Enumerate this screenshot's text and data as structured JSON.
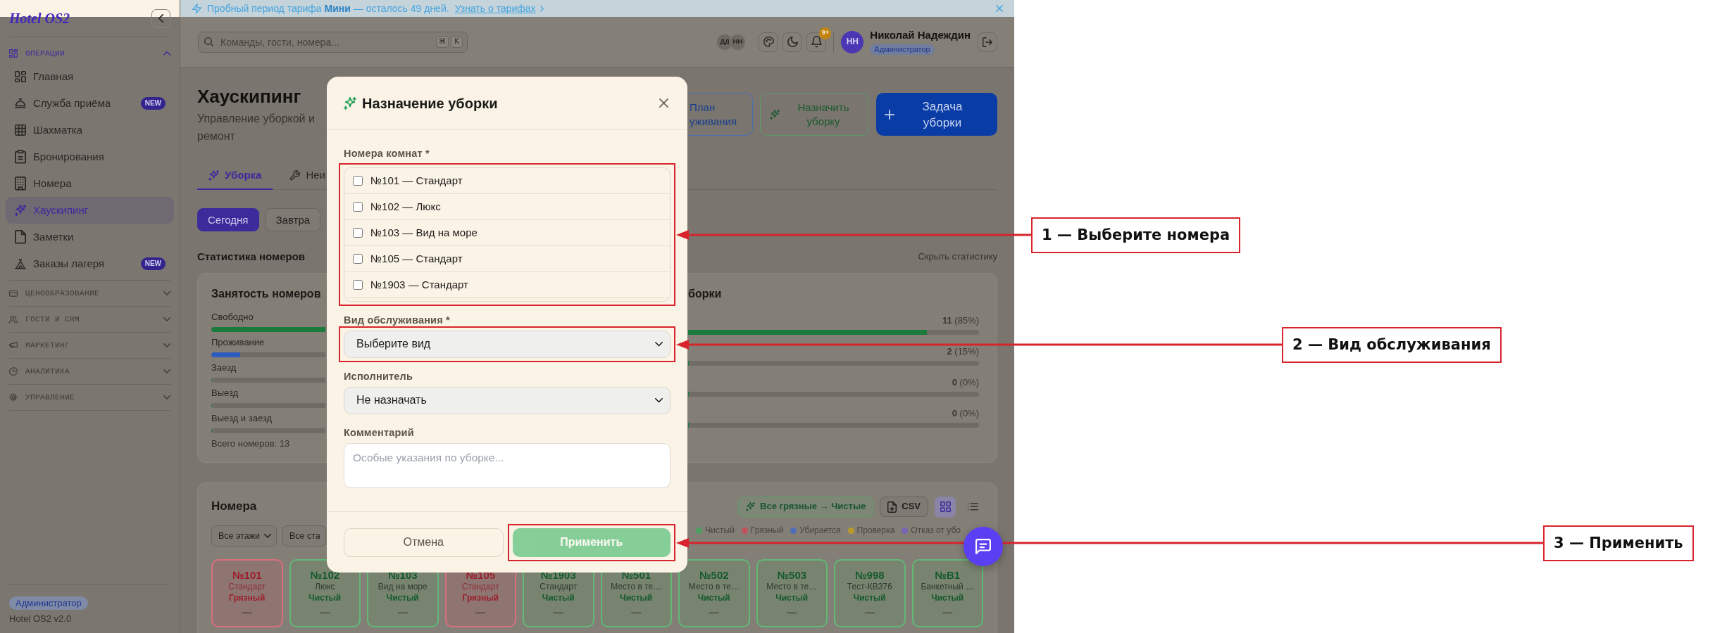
{
  "banner": {
    "text": "Пробный период тарифа **Мини** — осталось 49 дней.",
    "link": "Узнать о тарифах"
  },
  "sidebar": {
    "logo": "Hotel OS2",
    "sections": [
      {
        "title": "ОПЕРАЦИИ",
        "expanded": true,
        "items": [
          {
            "label": "Главная",
            "selected": false
          },
          {
            "label": "Служба приёма",
            "badge": "NEW",
            "selected": false
          },
          {
            "label": "Шахматка",
            "selected": false
          },
          {
            "label": "Бронирования",
            "selected": false
          },
          {
            "label": "Номера",
            "selected": false
          },
          {
            "label": "Хаускипинг",
            "selected": true
          },
          {
            "label": "Заметки",
            "selected": false
          },
          {
            "label": "Заказы лагеря",
            "badge": "NEW",
            "selected": false
          }
        ]
      },
      {
        "title": "ЦЕНООБРАЗОВАНИЕ",
        "expanded": false
      },
      {
        "title": "ГОСТИ И CRM",
        "expanded": false
      },
      {
        "title": "МАРКЕТИНГ",
        "expanded": false
      },
      {
        "title": "АНАЛИТИКА",
        "expanded": false
      },
      {
        "title": "УПРАВЛЕНИЕ",
        "expanded": false
      }
    ],
    "role": "Администратор",
    "version": "Hotel OS2 v2.0"
  },
  "topbar": {
    "search": {
      "placeholder": "Команды, гости, номера...",
      "keys": [
        "⌘",
        "K"
      ]
    },
    "online_users": [
      "ДД",
      "НН"
    ],
    "notifications": "9+",
    "user": {
      "initials": "НН",
      "name": "Николай Надеждин",
      "role": "Администратор"
    }
  },
  "page": {
    "title": "Хаускипинг",
    "subtitle": "Управление уборкой и ремонт",
    "actions": [
      {
        "label": "План уживания"
      },
      {
        "label": "Назначить уборку"
      },
      {
        "label": "Задача уборки"
      }
    ],
    "tabs": [
      {
        "label": "Уборка",
        "selected": true
      },
      {
        "label": "Неи",
        "selected": false
      }
    ],
    "days": [
      {
        "label": "Сегодня",
        "selected": true
      },
      {
        "label": "Завтра",
        "selected": false
      }
    ]
  },
  "stats": {
    "title": "Статистика номеров",
    "toggle": "Скрыть статистику",
    "occupancy": {
      "title": "Занятость номеров",
      "rows": [
        {
          "label": "Свободно",
          "level": 1,
          "color": "#1a7a3c"
        },
        {
          "label": "Проживание",
          "level": 0.25,
          "color": "#2c5cc0"
        },
        {
          "label": "Заезд",
          "level": 0
        },
        {
          "label": "Выезд",
          "level": 0
        },
        {
          "label": "Выезд и заезд",
          "level": 0
        }
      ],
      "total": "Всего номеров: 13"
    },
    "cleaning": {
      "title": "борки",
      "rows": [
        {
          "reading": "**11** (85%)",
          "level": 0.82
        },
        {
          "reading": "**2** (15%)",
          "level": 0
        },
        {
          "reading": "**0** (0%)",
          "level": 0
        },
        {
          "reading": "**0** (0%)",
          "level": 0
        }
      ]
    }
  },
  "rooms": {
    "title": "Номера",
    "actions": [
      {
        "label": "Все грязные → Чистые"
      },
      {
        "label": "CSV"
      }
    ],
    "views": [
      {
        "selected": true
      },
      {
        "selected": false
      }
    ],
    "filters": [
      {
        "value": "Все этажи",
        "dropdown_arrow": true
      },
      {
        "value": "Все ста"
      }
    ],
    "legend": [
      {
        "label": "Чистый",
        "color": "#4f9d63"
      },
      {
        "label": "Грязный",
        "color": "#c2525e"
      },
      {
        "label": "Убирается",
        "color": "#4d6fb8"
      },
      {
        "label": "Проверка",
        "color": "#b89a2c"
      },
      {
        "label": "Отказ от убо",
        "color": "#7b63b5"
      }
    ],
    "tiles": [
      {
        "number": "№101",
        "type": "Стандарт",
        "status": "Грязный",
        "kind": "dirty",
        "note": "—"
      },
      {
        "number": "№102",
        "type": "Люкс",
        "status": "Чистый",
        "kind": "clean",
        "note": "—"
      },
      {
        "number": "№103",
        "type": "Вид на море",
        "status": "Чистый",
        "kind": "clean",
        "note": "—"
      },
      {
        "number": "№105",
        "type": "Стандарт",
        "status": "Грязный",
        "kind": "dirty",
        "note": "—"
      },
      {
        "number": "№1903",
        "type": "Стандарт",
        "status": "Чистый",
        "kind": "clean",
        "note": "—"
      },
      {
        "number": "№501",
        "type": "Место в те…",
        "status": "Чистый",
        "kind": "clean",
        "note": "—"
      },
      {
        "number": "№502",
        "type": "Место в те…",
        "status": "Чистый",
        "kind": "clean",
        "note": "—"
      },
      {
        "number": "№503",
        "type": "Место в те…",
        "status": "Чистый",
        "kind": "clean",
        "note": "—"
      },
      {
        "number": "№998",
        "type": "Тест-КВ376",
        "status": "Чистый",
        "kind": "clean",
        "note": "—"
      },
      {
        "number": "№В1",
        "type": "Банкетный …",
        "status": "Чистый",
        "kind": "clean",
        "note": "—"
      }
    ]
  },
  "modal": {
    "title": "Назначение уборки",
    "rooms": {
      "label": "Номера комнат *",
      "callout": "1 — Выберите номера",
      "options": [
        {
          "label": "№101 — Стандарт",
          "checked": false
        },
        {
          "label": "№102 — Люкс",
          "checked": false
        },
        {
          "label": "№103 — Вид на море",
          "checked": false
        },
        {
          "label": "№105 — Стандарт",
          "checked": false
        },
        {
          "label": "№1903 — Стандарт",
          "checked": false
        }
      ]
    },
    "service": {
      "label": "Вид обслуживания *",
      "value": "Выберите вид",
      "callout": "2 — Вид обслуживания"
    },
    "assignee": {
      "label": "Исполнитель",
      "value": "Не назначать"
    },
    "comment": {
      "label": "Комментарий",
      "placeholder": "Особые указания по уборке..."
    },
    "cancel": "Отмена",
    "apply": {
      "label": "Применить",
      "disabled": true,
      "callout": "3 — Применить"
    }
  }
}
